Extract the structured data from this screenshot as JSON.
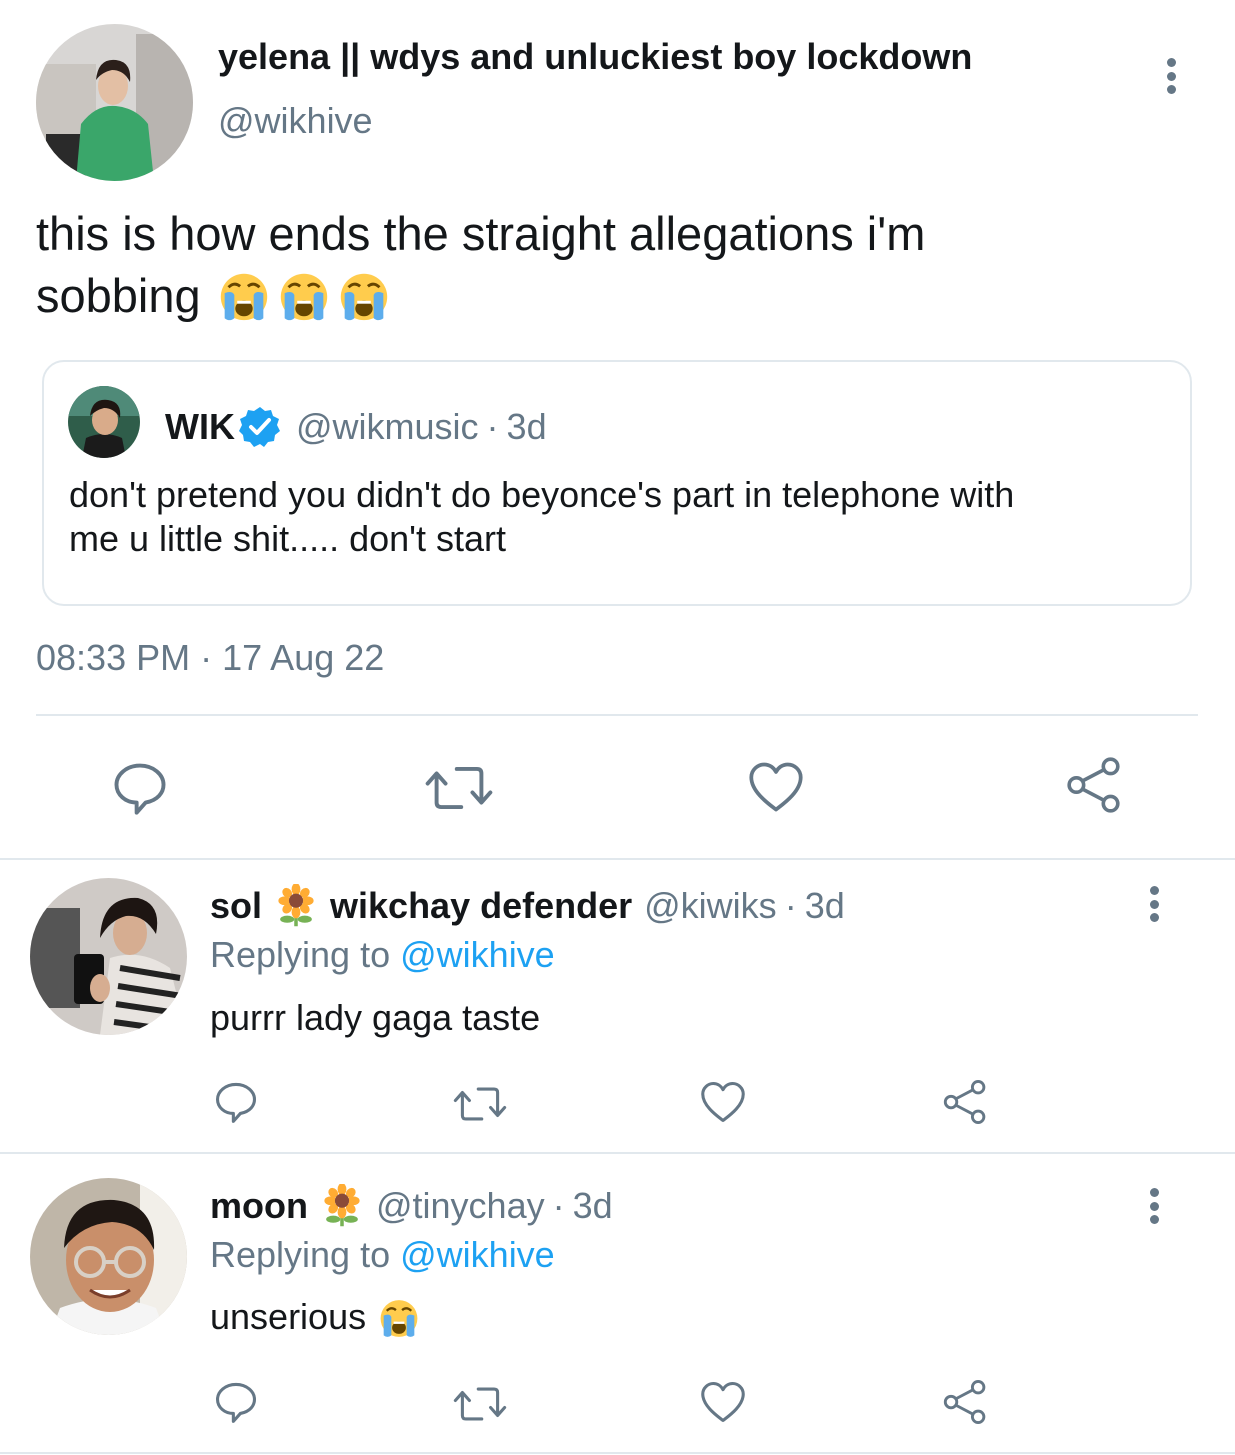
{
  "tweet": {
    "author_name": "yelena || wdys and unluckiest boy lockdown",
    "author_handle": "@wikhive",
    "text_line1": "this is how ends the straight allegations i'm",
    "text_line2": "sobbing",
    "emoji_icon": "loudly-crying-face-icon",
    "time": "08:33 PM",
    "dot": "·",
    "date": "17 Aug 22"
  },
  "quote": {
    "name": "WIK",
    "verified_icon": "verified-badge-icon",
    "handle": "@wikmusic",
    "dot": "·",
    "age": "3d",
    "text_line1": "don't pretend you didn't do beyonce's part in telephone with",
    "text_line2": "me u little shit..... don't start"
  },
  "replies": [
    {
      "name_part1": "sol",
      "name_icon": "sunflower-icon",
      "name_part2": "wikchay defender",
      "handle": "@kiwiks",
      "dot": "·",
      "age": "3d",
      "replying_label": "Replying to",
      "replying_handle": "@wikhive",
      "text": "purrr lady gaga taste"
    },
    {
      "name_part1": "moon",
      "name_icon": "sunflower-icon",
      "handle": "@tinychay",
      "dot": "·",
      "age": "3d",
      "replying_label": "Replying to",
      "replying_handle": "@wikhive",
      "text": "unserious",
      "emoji_icon": "loudly-crying-face-icon"
    }
  ],
  "actions": [
    "reply-icon",
    "retweet-icon",
    "like-icon",
    "share-icon"
  ],
  "colors": {
    "text": "#14171a",
    "secondary": "#657786",
    "link": "#1da1f2",
    "divider": "#e1e8ed",
    "verified": "#1da1f2"
  }
}
